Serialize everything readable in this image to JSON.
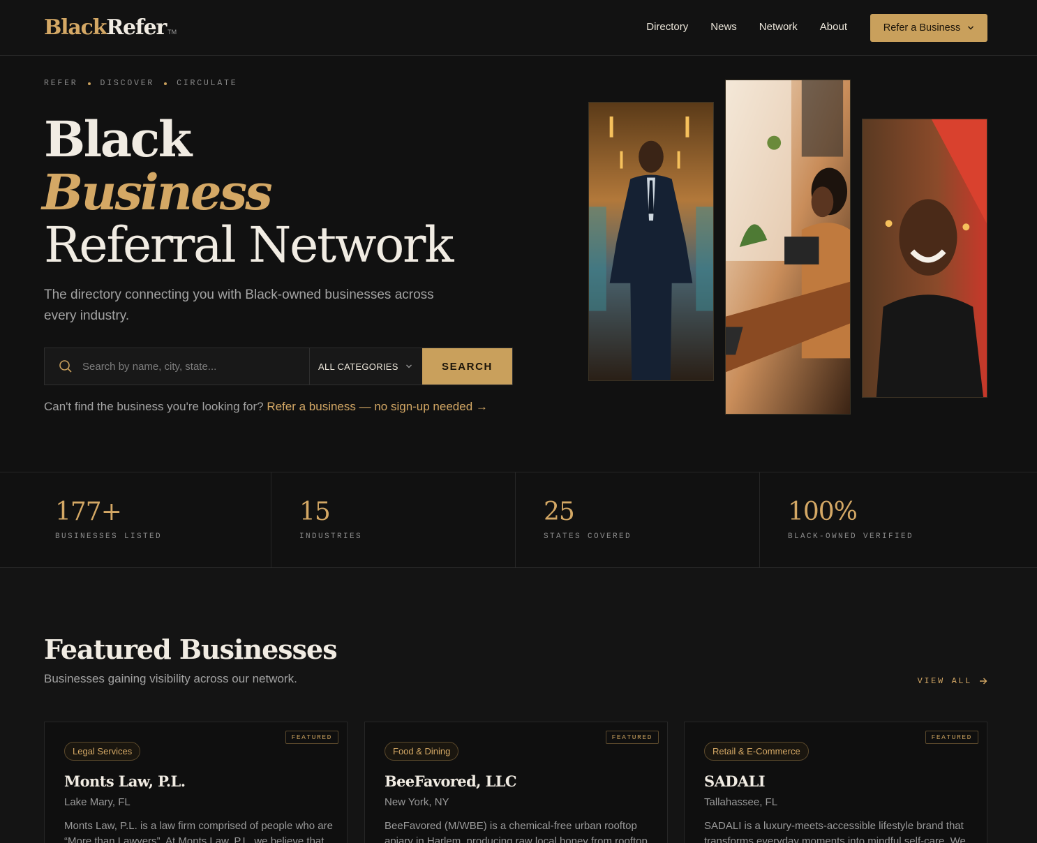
{
  "brand": {
    "name_part1": "Black",
    "name_part2": "Refer",
    "trademark": "TM"
  },
  "nav": {
    "links": [
      "Directory",
      "News",
      "Network",
      "About"
    ],
    "cta_label": "Refer a Business"
  },
  "hero": {
    "eyebrow": [
      "REFER",
      "DISCOVER",
      "CIRCULATE"
    ],
    "title_line1": "Black",
    "title_line2": "Business",
    "title_line3": "Referral Network",
    "subtitle": "The directory connecting you with Black-owned businesses across every industry.",
    "search": {
      "placeholder": "Search by name, city, state...",
      "category_value": "ALL CATEGORIES",
      "button_label": "SEARCH"
    },
    "cant_find_text": "Can't find the business you're looking for?",
    "cant_find_link": "Refer a business — no sign-up needed →"
  },
  "stats": [
    {
      "value": "177+",
      "label": "BUSINESSES LISTED"
    },
    {
      "value": "15",
      "label": "INDUSTRIES"
    },
    {
      "value": "25",
      "label": "STATES COVERED"
    },
    {
      "value": "100%",
      "label": "BLACK-OWNED VERIFIED"
    }
  ],
  "featured": {
    "title": "Featured Businesses",
    "subtitle": "Businesses gaining visibility across our network.",
    "view_all": "VIEW ALL",
    "cards": [
      {
        "badge": "FEATURED",
        "category": "Legal Services",
        "name": "Monts Law, P.L.",
        "location": "Lake Mary, FL",
        "description": "Monts Law, P.L. is a law firm comprised of people who are “More than Lawyers”. At Monts Law, P.L. we believe that"
      },
      {
        "badge": "FEATURED",
        "category": "Food & Dining",
        "name": "BeeFavored, LLC",
        "location": "New York, NY",
        "description": "BeeFavored (M/WBE) is a chemical-free urban rooftop apiary in Harlem, producing raw local honey from rooftop"
      },
      {
        "badge": "FEATURED",
        "category": "Retail & E-Commerce",
        "name": "SADALI",
        "location": "Tallahassee, FL",
        "description": "SADALI is a luxury-meets-accessible lifestyle brand that transforms everyday moments into mindful self-care. We"
      }
    ]
  },
  "colors": {
    "accent": "#c9a05c",
    "accent_light": "#d4a865",
    "background": "#111111",
    "text": "#ece6da"
  },
  "icons": [
    "search-icon",
    "chevron-down-icon",
    "arrow-right-icon"
  ]
}
